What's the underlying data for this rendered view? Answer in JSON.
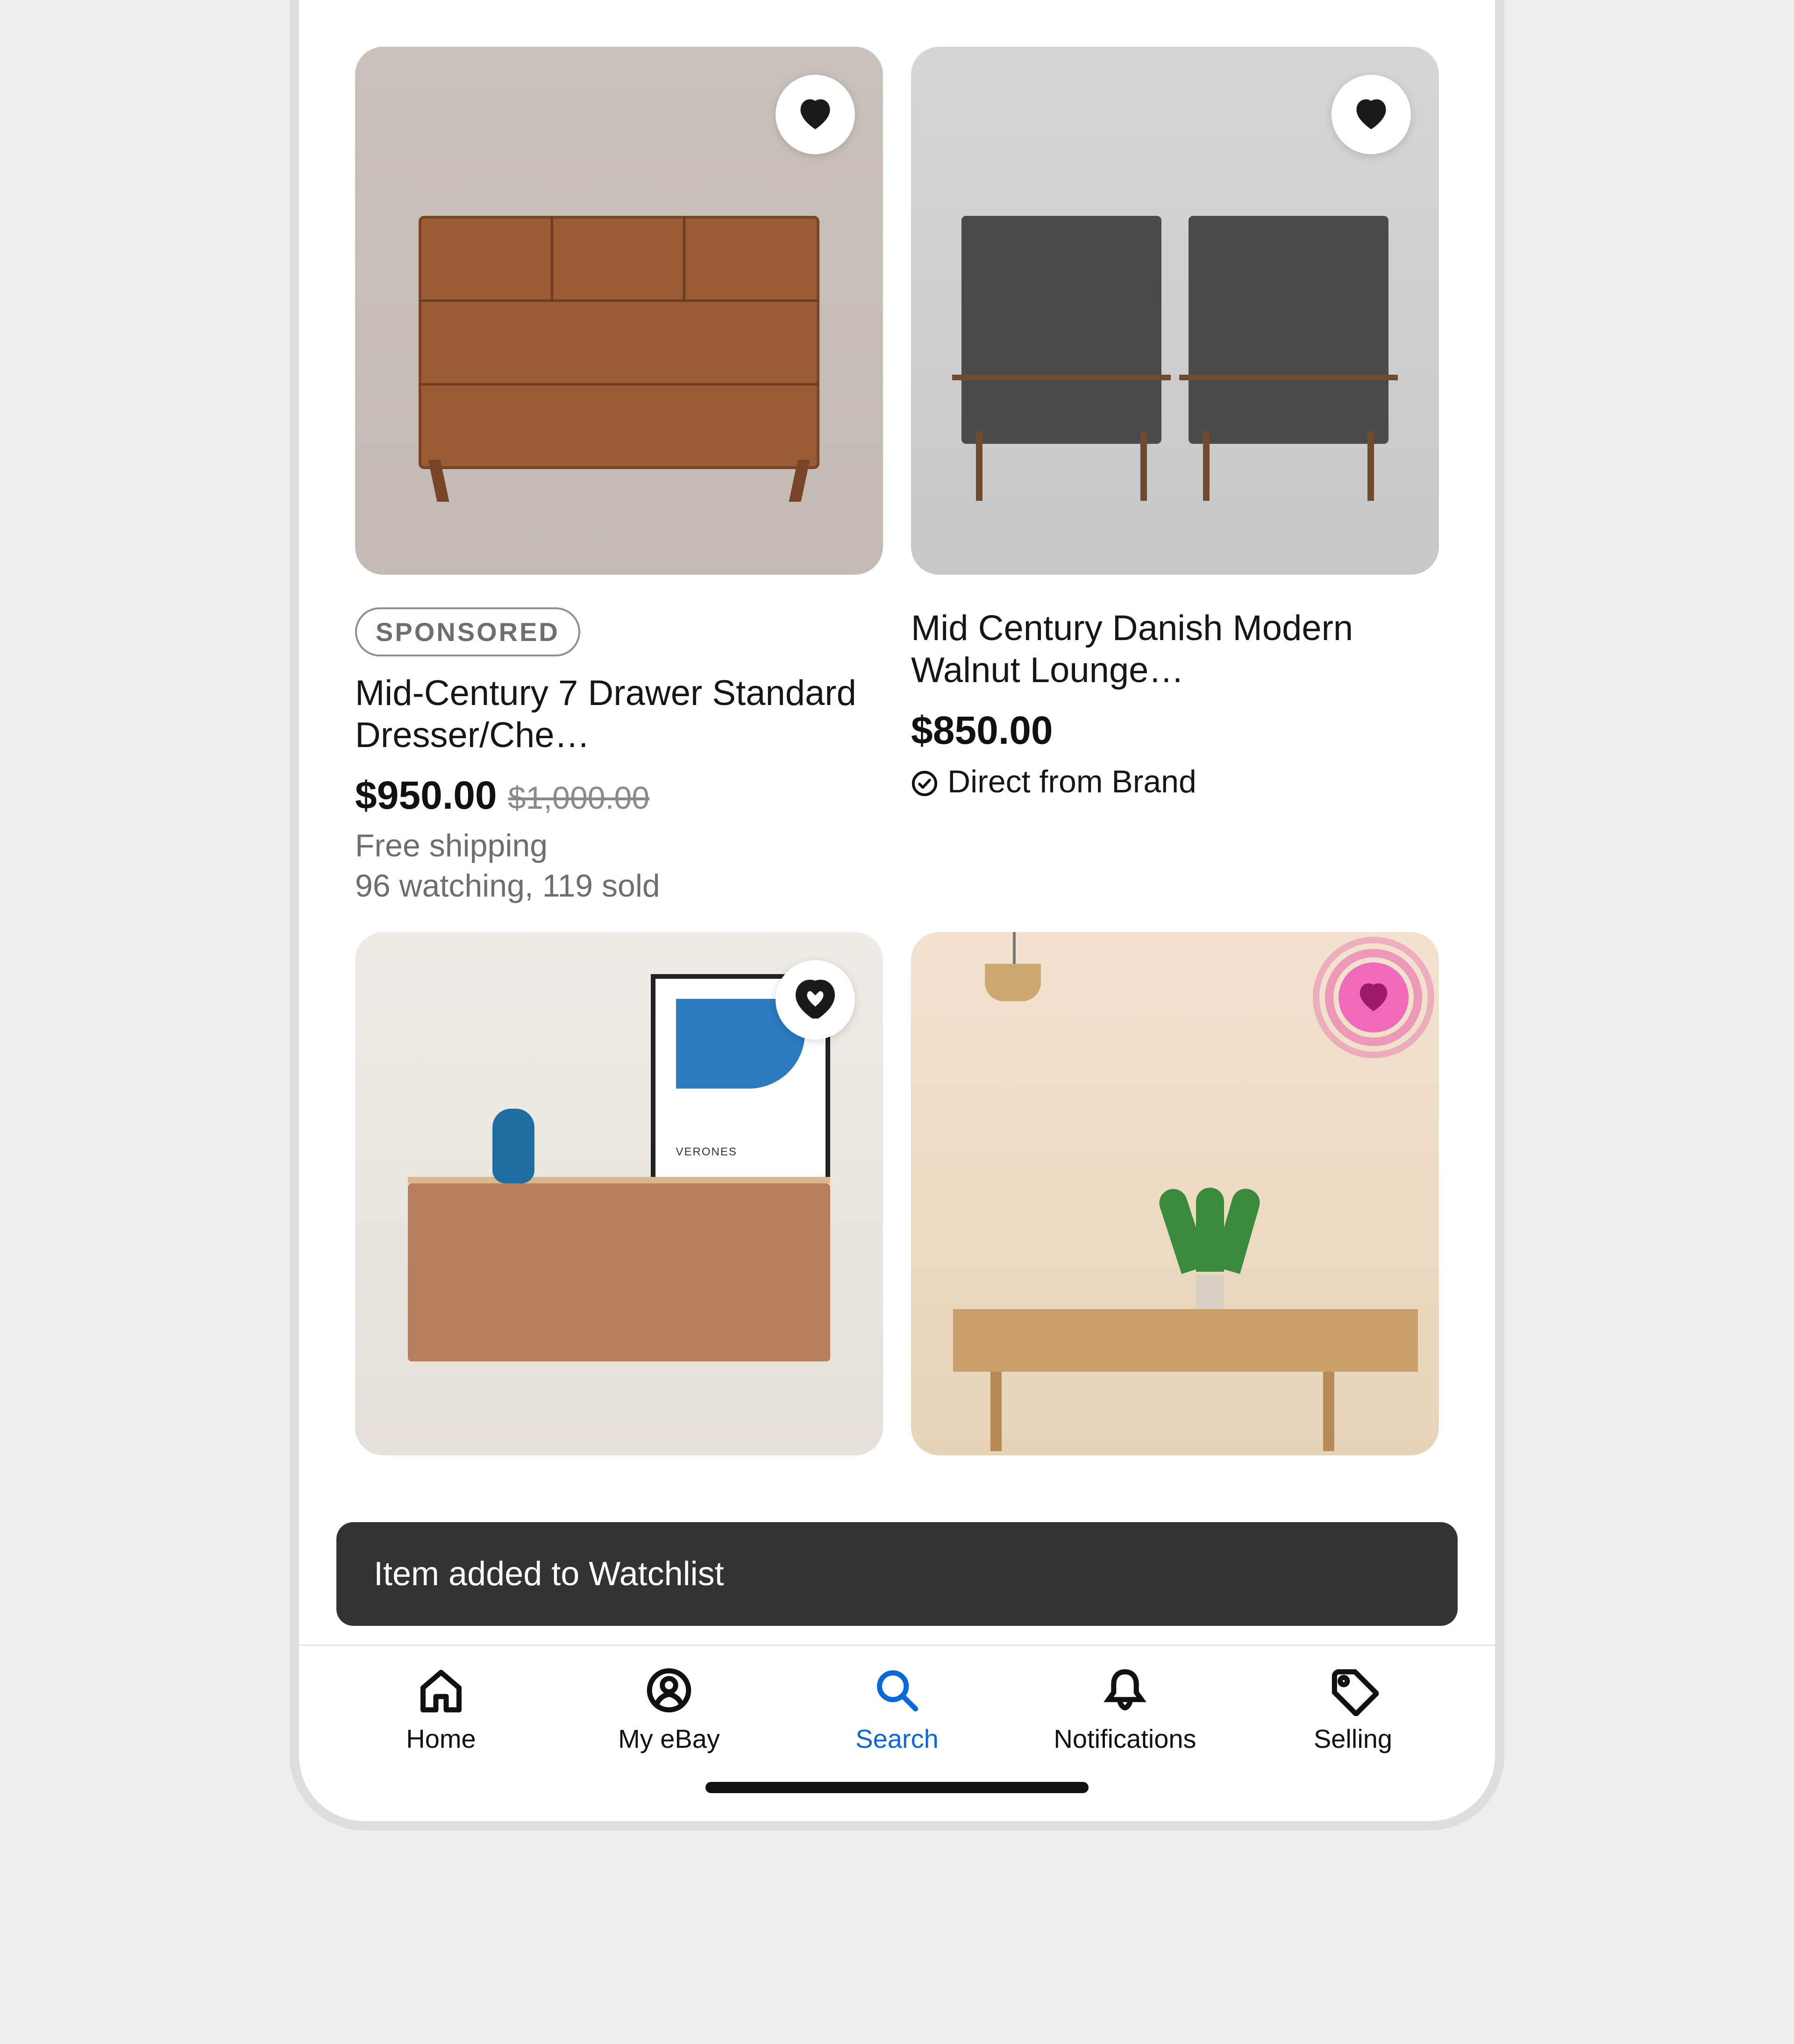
{
  "products": [
    {
      "sponsored_label": "SPONSORED",
      "title": "Mid-Century 7 Drawer Standard Dresser/Che…",
      "price": "$950.00",
      "original_price": "$1,000.00",
      "shipping": "Free shipping",
      "stats": "96 watching, 119 sold",
      "favorited": true
    },
    {
      "title": "Mid Century Danish Modern Walnut Lounge…",
      "price": "$850.00",
      "direct_label": "Direct from Brand",
      "favorited": true
    },
    {
      "favorited": false
    },
    {
      "favorited_active": true
    }
  ],
  "poster_text": "VERONES",
  "toast": {
    "message": "Item added to Watchlist"
  },
  "nav": {
    "items": [
      {
        "label": "Home"
      },
      {
        "label": "My eBay"
      },
      {
        "label": "Search",
        "active": true
      },
      {
        "label": "Notifications"
      },
      {
        "label": "Selling"
      }
    ]
  }
}
